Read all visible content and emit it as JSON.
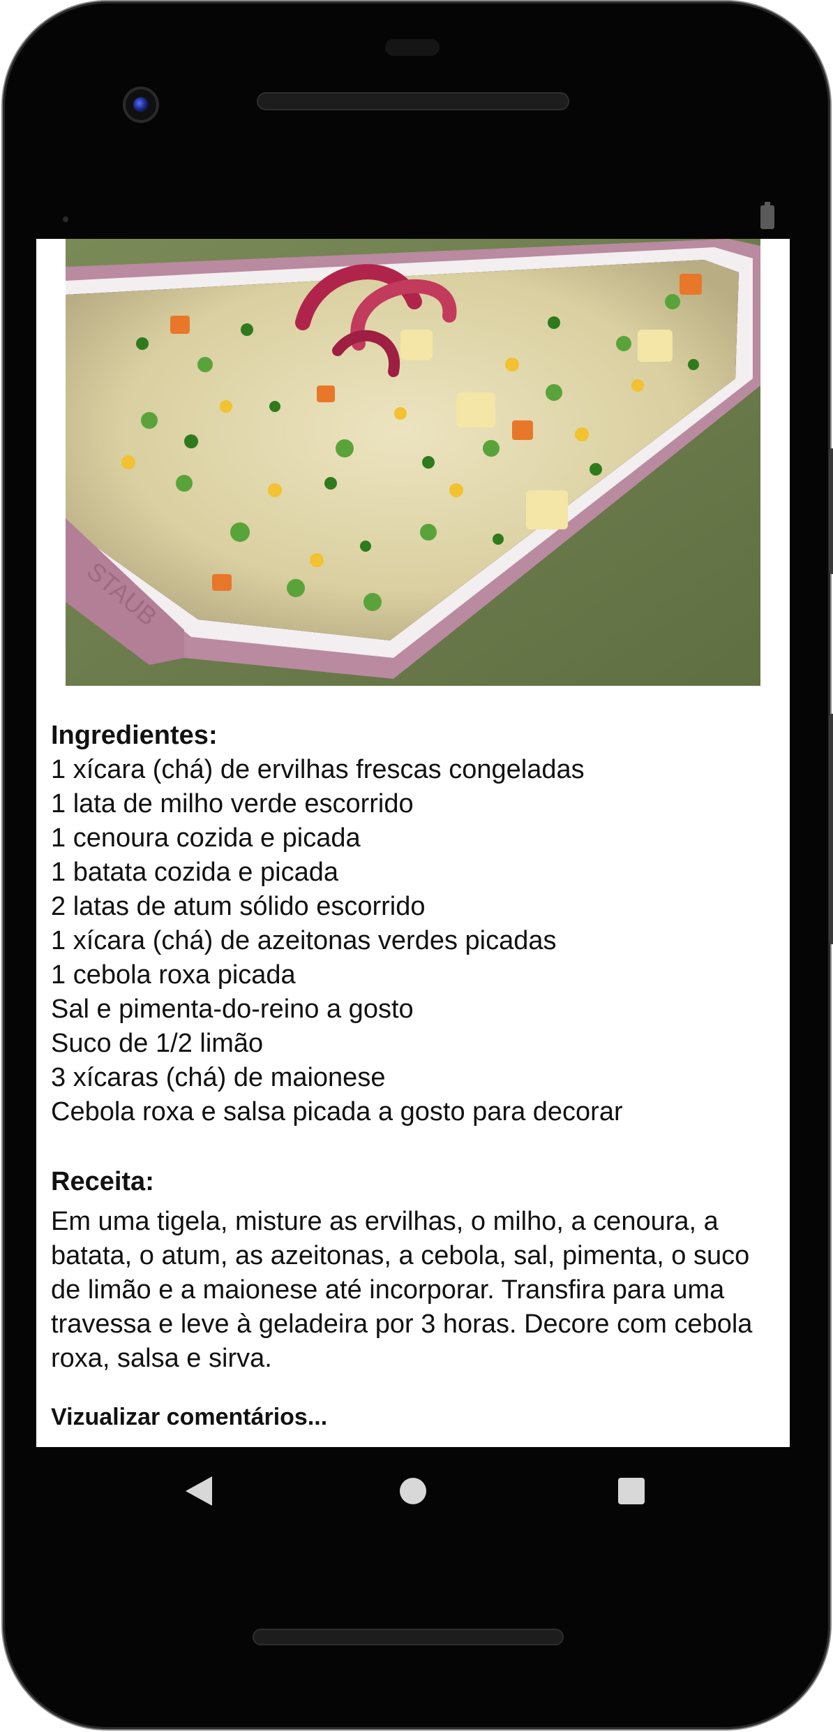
{
  "recipe": {
    "image_alt": "Salpicão de atum com ervilhas, milho e cenoura",
    "ingredients_heading": "Ingredientes:",
    "ingredients": [
      "1 xícara (chá) de ervilhas frescas congeladas",
      "1 lata de milho verde escorrido",
      "1 cenoura cozida e picada",
      "1 batata cozida e picada",
      "2 latas de atum sólido escorrido",
      "1 xícara (chá) de azeitonas verdes picadas",
      "1 cebola roxa picada",
      "Sal e pimenta-do-reino a gosto",
      "Suco de 1/2 limão",
      "3 xícaras (chá) de maionese",
      "Cebola roxa e salsa picada a gosto para decorar"
    ],
    "method_heading": "Receita:",
    "method": "Em uma tigela, misture as ervilhas, o milho, a cenoura, a batata, o atum, as azeitonas, a cebola, sal, pimenta, o suco de limão e a maionese até incorporar. Transfira para uma travessa e leve à geladeira por 3 horas. Decore com cebola roxa, salsa e sirva.",
    "view_comments": "Vizualizar comentários..."
  },
  "navigation": {
    "back_icon": "triangle-back-icon",
    "home_icon": "circle-home-icon",
    "recents_icon": "square-recents-icon"
  },
  "colors": {
    "tablecloth": "#6f7f4e",
    "dish_rim": "#b98aa0",
    "salad": "#e4dcb2",
    "onion": "#b0244b",
    "parsley": "#2f7a1c",
    "carrot": "#e8772a"
  }
}
